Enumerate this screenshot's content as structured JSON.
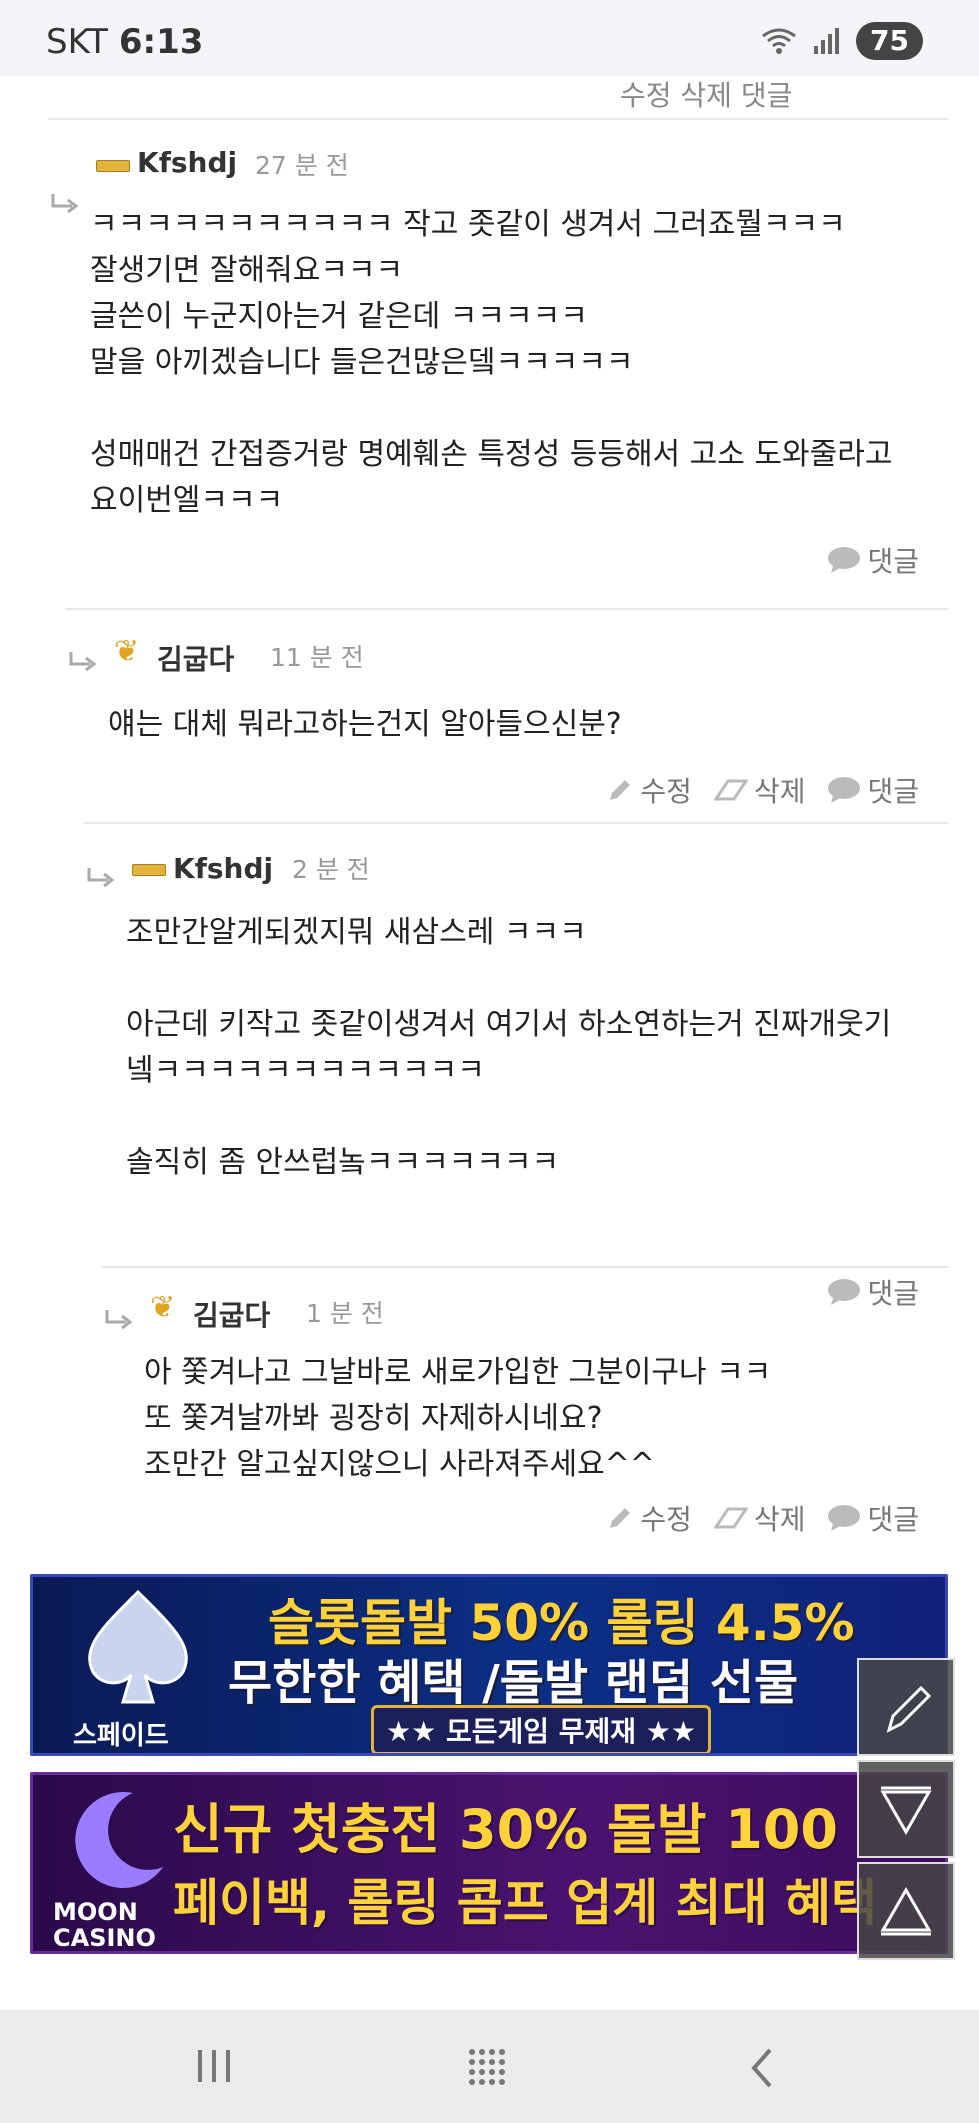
{
  "status_bar": {
    "carrier": "SKT",
    "time": "6:13",
    "battery": "75"
  },
  "top_cut_actions": "수정  삭제  댓글",
  "comments": [
    {
      "author": "Kfshdj",
      "time": "27 분 전",
      "body": "ㅋㅋㅋㅋㅋㅋㅋㅋㅋㅋㅋ 작고 좃같이 생겨서 그러죠뭘ㅋㅋㅋ\n잘생기면 잘해줘요ㅋㅋㅋ\n글쓴이 누군지아는거 같은데 ㅋㅋㅋㅋㅋ\n말을 아끼겠습니다 들은건많은뎈ㅋㅋㅋㅋㅋ\n\n성매매건 간접증거랑 명예훼손 특정성 등등해서 고소 도와줄라고\n요이번엘ㅋㅋㅋ",
      "reply_label": "댓글"
    },
    {
      "author": "김굽다",
      "time": "11 분 전",
      "body": "얘는 대체 뭐라고하는건지 알아들으신분?",
      "edit_label": "수정",
      "delete_label": "삭제",
      "reply_label": "댓글"
    },
    {
      "author": "Kfshdj",
      "time": "2 분 전",
      "body": "조만간알게되겠지뭐 새삼스레 ㅋㅋㅋ\n\n아근데 키작고 좃같이생겨서 여기서 하소연하는거 진짜개웃기\n넼ㅋㅋㅋㅋㅋㅋㅋㅋㅋㅋㅋㅋ\n\n솔직히 좀 안쓰럽놐ㅋㅋㅋㅋㅋㅋㅋ",
      "reply_label": "댓글"
    },
    {
      "author": "김굽다",
      "time": "1 분 전",
      "body": "아 쫓겨나고 그날바로 새로가입한 그분이구나 ㅋㅋ\n또 쫓겨날까봐 굉장히 자제하시네요?\n조만간 알고싶지않으니 사라져주세요^^",
      "edit_label": "수정",
      "delete_label": "삭제",
      "reply_label": "댓글"
    }
  ],
  "ads": [
    {
      "brand": "스페이드",
      "line1": "슬롯돌발 50% 롤링 4.5%",
      "line2": "무한한 혜택 /돌발 랜덤 선물",
      "line3": "★★ 모든게임 무제재 ★★"
    },
    {
      "brand": "MOON CASINO",
      "line1": "신규 첫충전 30% 돌발 100",
      "line2": "페이백, 롤링 콤프 업계 최대 혜택"
    }
  ]
}
